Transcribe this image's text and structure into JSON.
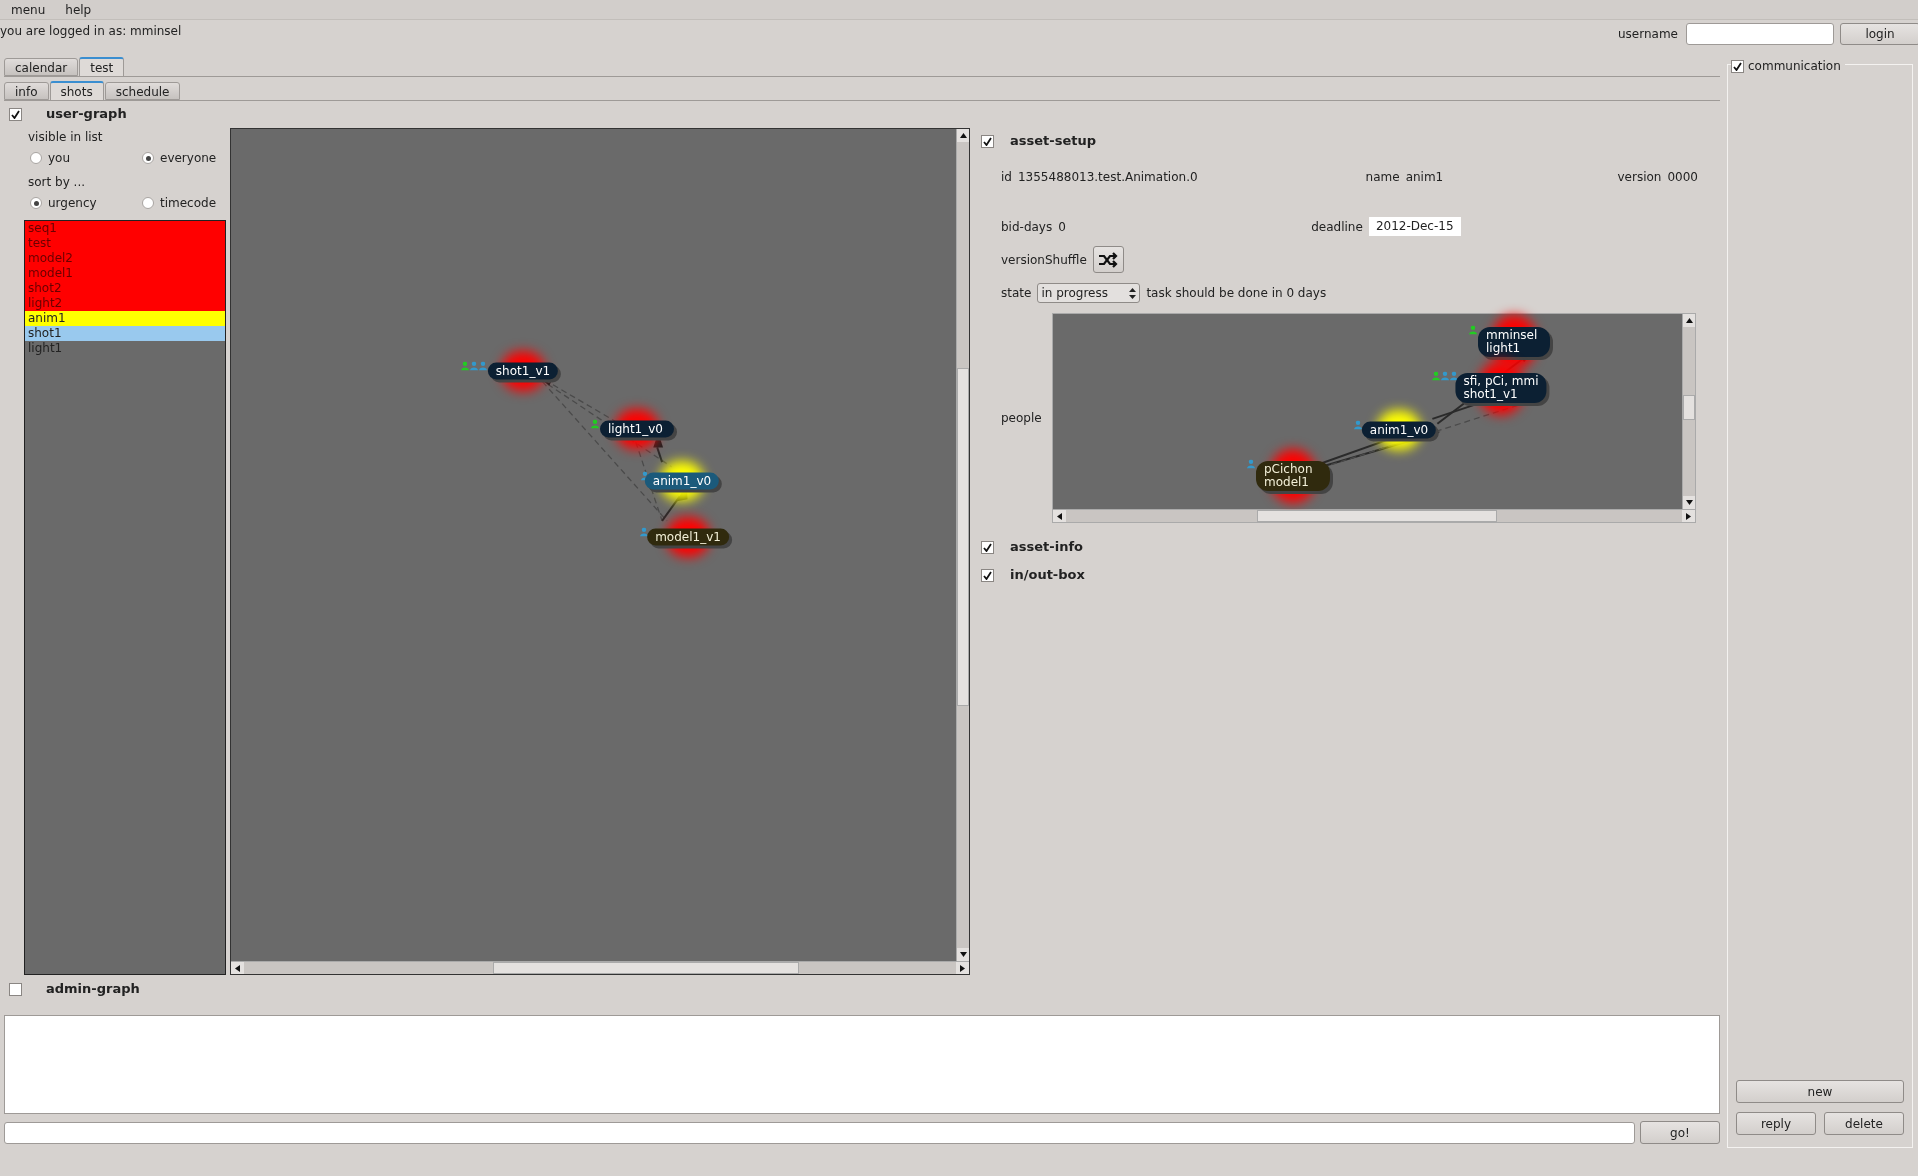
{
  "menu": [
    {
      "label": "menu"
    },
    {
      "label": "help"
    }
  ],
  "login_status": "you are logged in as: mminsel",
  "login": {
    "label": "username",
    "button": "login"
  },
  "tabs": [
    {
      "label": "calendar",
      "selected": false
    },
    {
      "label": "test",
      "selected": true
    }
  ],
  "subtabs": [
    {
      "label": "info",
      "selected": false
    },
    {
      "label": "shots",
      "selected": true
    },
    {
      "label": "schedule",
      "selected": false
    }
  ],
  "user_graph": {
    "title": "user-graph",
    "checked": true,
    "visible_in_list": {
      "label": "visible in list",
      "options": [
        {
          "label": "you",
          "selected": false
        },
        {
          "label": "everyone",
          "selected": true
        }
      ]
    },
    "sort_by": {
      "label": "sort by ...",
      "options": [
        {
          "label": "urgency",
          "selected": true
        },
        {
          "label": "timecode",
          "selected": false
        }
      ]
    },
    "list": [
      {
        "label": "seq1",
        "color": "#ff0000"
      },
      {
        "label": "test",
        "color": "#ff0000"
      },
      {
        "label": "model2",
        "color": "#ff0000"
      },
      {
        "label": "model1",
        "color": "#ff0000"
      },
      {
        "label": "shot2",
        "color": "#ff0000"
      },
      {
        "label": "light2",
        "color": "#ff0000"
      },
      {
        "label": "anim1",
        "color": "#ffff00"
      },
      {
        "label": "shot1",
        "color": "#99c9ee"
      },
      {
        "label": "light1"
      }
    ],
    "graph": {
      "nodes": [
        {
          "lines": [
            "shot1_v1"
          ],
          "kind": "asset",
          "selected": false,
          "color": "#ff0000",
          "people": [
            {
              "color": "#22cc22"
            },
            {
              "color": "#3399cc"
            },
            {
              "color": "#3399cc"
            }
          ]
        },
        {
          "lines": [
            "light1_v0"
          ],
          "kind": "asset",
          "selected": false,
          "color": "#ff0000",
          "people": [
            {
              "color": "#22cc22"
            }
          ]
        },
        {
          "lines": [
            "anim1_v0"
          ],
          "kind": "asset",
          "selected": true,
          "color": "#ffff00",
          "people": [
            {
              "color": "#3399cc"
            }
          ]
        },
        {
          "lines": [
            "model1_v1"
          ],
          "kind": "model",
          "selected": false,
          "color": "#ff0000",
          "people": [
            {
              "color": "#3399cc"
            }
          ]
        }
      ]
    }
  },
  "asset_setup": {
    "title": "asset-setup",
    "checked": true,
    "id": {
      "label": "id",
      "value": "1355488013.test.Animation.0"
    },
    "name": {
      "label": "name",
      "value": "anim1"
    },
    "version": {
      "label": "version",
      "value": "0000"
    },
    "bid_days": {
      "label": "bid-days",
      "value": "0"
    },
    "deadline": {
      "label": "deadline",
      "value": "2012-Dec-15"
    },
    "version_shuffle": {
      "label": "versionShuffle"
    },
    "state": {
      "label": "state",
      "value": "in progress",
      "note": "task should be done in 0 days"
    },
    "people": {
      "label": "people",
      "nodes": [
        {
          "lines": [
            "mminsel",
            "light1"
          ],
          "kind": "asset",
          "selected": false,
          "color": "#ff0000",
          "people": [
            {
              "color": "#22cc22"
            }
          ]
        },
        {
          "lines": [
            "sfi, pCi, mmi",
            "shot1_v1"
          ],
          "kind": "asset",
          "selected": false,
          "color": "#ff0000",
          "people": [
            {
              "color": "#22cc22"
            },
            {
              "color": "#3399cc"
            },
            {
              "color": "#3399cc"
            }
          ]
        },
        {
          "lines": [
            "anim1_v0"
          ],
          "kind": "asset",
          "selected": false,
          "color": "#ffff00",
          "people": [
            {
              "color": "#3399cc"
            }
          ]
        },
        {
          "lines": [
            "pCichon",
            "model1"
          ],
          "kind": "model",
          "selected": false,
          "color": "#ff0000",
          "people": [
            {
              "color": "#3399cc"
            }
          ]
        }
      ]
    }
  },
  "sections": [
    {
      "title": "asset-info",
      "checked": true
    },
    {
      "title": "in/out-box",
      "checked": true
    }
  ],
  "admin_graph": {
    "title": "admin-graph",
    "checked": false
  },
  "message": {
    "button": "go!"
  },
  "communication": {
    "title": "communication",
    "checked": true,
    "buttons": [
      {
        "label": "new"
      },
      {
        "label": "reply"
      },
      {
        "label": "delete"
      }
    ]
  }
}
